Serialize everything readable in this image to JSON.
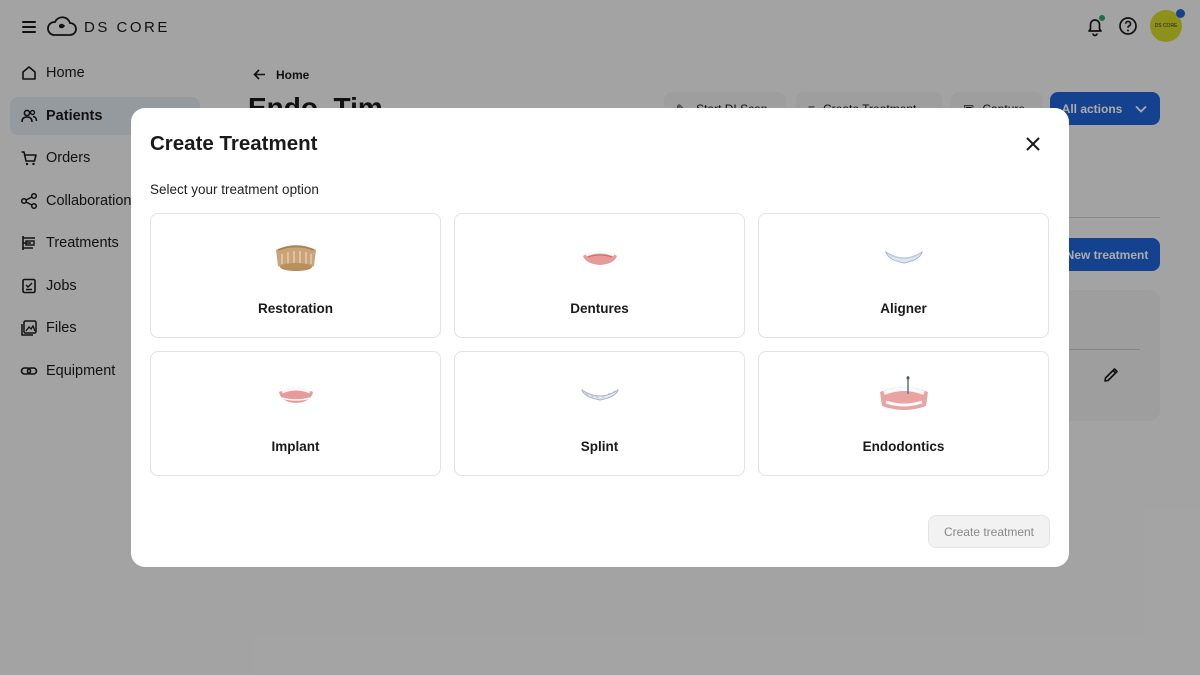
{
  "brand": {
    "name": "DS CORE"
  },
  "sidebar": {
    "items": [
      {
        "label": "Home",
        "icon": "home-icon",
        "active": false
      },
      {
        "label": "Patients",
        "icon": "patients-icon",
        "active": true
      },
      {
        "label": "Orders",
        "icon": "cart-icon",
        "active": false
      },
      {
        "label": "Collaboration",
        "icon": "share-icon",
        "active": false
      },
      {
        "label": "Treatments",
        "icon": "treatments-icon",
        "active": false
      },
      {
        "label": "Jobs",
        "icon": "jobs-icon",
        "active": false
      },
      {
        "label": "Files",
        "icon": "files-icon",
        "active": false
      },
      {
        "label": "Equipment",
        "icon": "equipment-icon",
        "active": false
      }
    ]
  },
  "header": {
    "avatar_text": "DS CORE"
  },
  "page": {
    "back_label": "Home",
    "patient_name": "Endo, Tim",
    "actions": {
      "start_scan": "Start DI Scan",
      "create_treatment": "Create Treatment",
      "capture": "Capture",
      "all_actions": "All actions"
    },
    "new_treatment": "New treatment"
  },
  "modal": {
    "title": "Create Treatment",
    "subtitle": "Select your treatment option",
    "options": [
      {
        "label": "Restoration"
      },
      {
        "label": "Dentures"
      },
      {
        "label": "Aligner"
      },
      {
        "label": "Implant"
      },
      {
        "label": "Splint"
      },
      {
        "label": "Endodontics"
      }
    ],
    "submit_label": "Create treatment"
  },
  "colors": {
    "accent": "#1e63d6",
    "active_nav": "#dfe6ec",
    "notification": "#2fa56a"
  }
}
